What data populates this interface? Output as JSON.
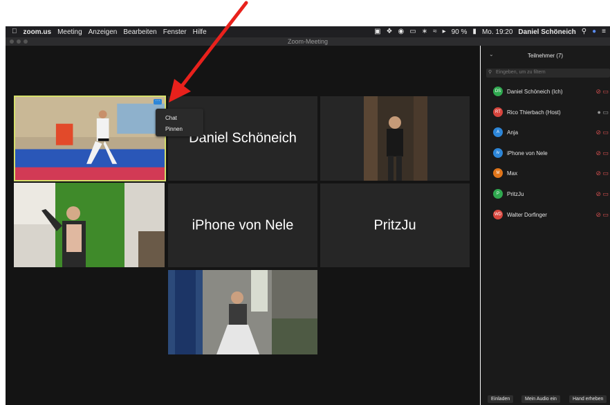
{
  "menubar": {
    "app": "zoom.us",
    "items": [
      "Meeting",
      "Anzeigen",
      "Bearbeiten",
      "Fenster",
      "Hilfe"
    ],
    "battery": "90 %",
    "clock": "Mo. 19:20",
    "user": "Daniel Schöneich"
  },
  "window": {
    "title": "Zoom-Meeting"
  },
  "tiles": {
    "daniel": "Daniel Schöneich",
    "nele": "iPhone von Nele",
    "pritzju": "PritzJu"
  },
  "context_menu": {
    "chat": "Chat",
    "pin": "Pinnen"
  },
  "panel": {
    "title": "Teilnehmer (7)",
    "filter_placeholder": "Eingeben, um zu filtern",
    "participants": [
      {
        "initials": "DS",
        "name": "Daniel Schöneich (Ich)",
        "color": "#2fa84f"
      },
      {
        "initials": "RT",
        "name": "Rico Thierbach (Host)",
        "color": "#d6453d"
      },
      {
        "initials": "A",
        "name": "Anja",
        "color": "#2d86d8"
      },
      {
        "initials": "iv",
        "name": "iPhone von Nele",
        "color": "#2d86d8"
      },
      {
        "initials": "M",
        "name": "Max",
        "color": "#e0751a"
      },
      {
        "initials": "P",
        "name": "PritzJu",
        "color": "#2fa84f"
      },
      {
        "initials": "WD",
        "name": "Walter Dorfinger",
        "color": "#d6453d"
      }
    ],
    "buttons": {
      "invite": "Einladen",
      "audio": "Mein Audio ein",
      "hand": "Hand erheben"
    }
  },
  "annotation": {
    "arrow_color": "#e8211c"
  },
  "icons": [
    "apple-icon",
    "search-icon",
    "wifi-icon",
    "bluetooth-icon",
    "battery-icon",
    "more-icon",
    "mic-muted-icon",
    "video-off-icon",
    "chevron-down-icon"
  ]
}
